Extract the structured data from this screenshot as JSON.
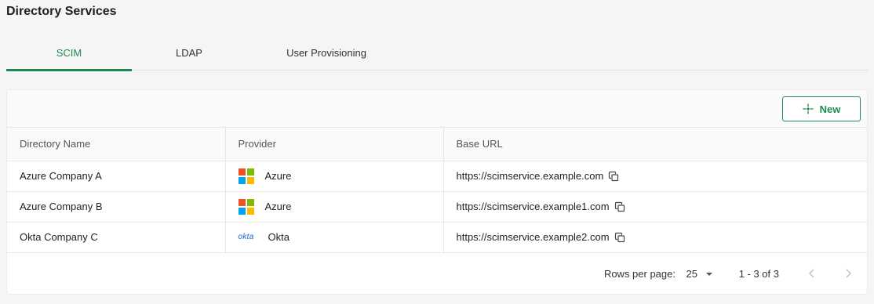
{
  "page": {
    "title": "Directory Services"
  },
  "tabs": [
    {
      "label": "SCIM",
      "active": true
    },
    {
      "label": "LDAP",
      "active": false
    },
    {
      "label": "User Provisioning",
      "active": false
    }
  ],
  "toolbar": {
    "new_label": "New",
    "new_icon": "sparkle-plus-icon"
  },
  "table": {
    "headers": [
      "Directory Name",
      "Provider",
      "Base URL"
    ],
    "rows": [
      {
        "name": "Azure Company A",
        "provider": "Azure",
        "provider_logo": "microsoft-logo",
        "url": "https://scimservice.example.com"
      },
      {
        "name": "Azure Company B",
        "provider": "Azure",
        "provider_logo": "microsoft-logo",
        "url": "https://scimservice.example1.com"
      },
      {
        "name": "Okta Company C",
        "provider": "Okta",
        "provider_logo": "okta",
        "url": "https://scimservice.example2.com"
      }
    ]
  },
  "pagination": {
    "rows_per_page_label": "Rows per page:",
    "rows_per_page_value": "25",
    "range": "1 - 3 of 3"
  },
  "colors": {
    "accent": "#1e8a4f",
    "ms_red": "#f25022",
    "ms_green": "#7fba00",
    "ms_blue": "#00a4ef",
    "ms_yellow": "#ffb900",
    "okta_blue": "#1a5fd0"
  }
}
